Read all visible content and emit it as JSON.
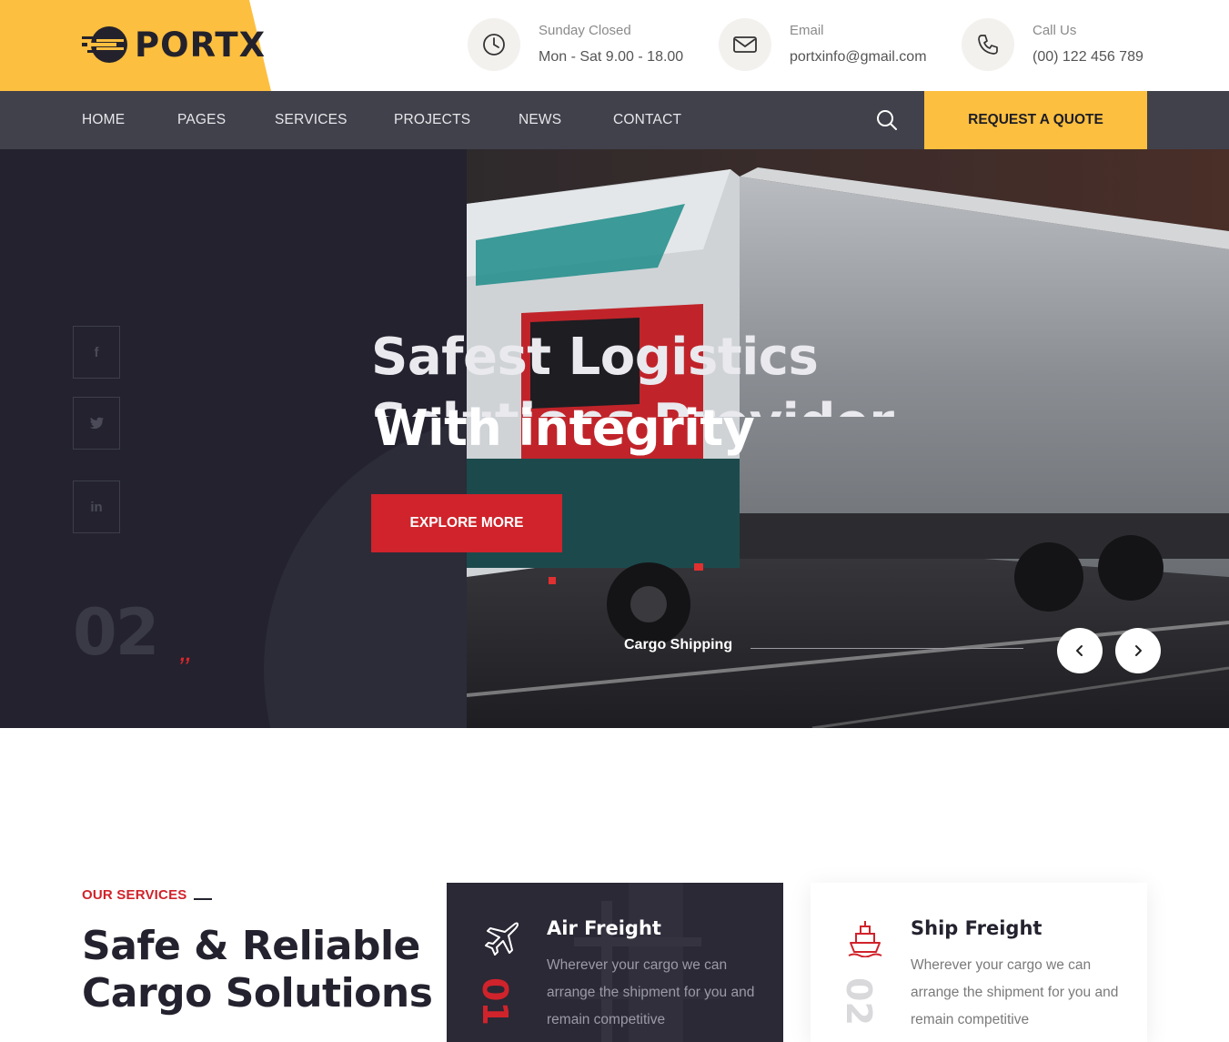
{
  "brand": {
    "name": "PORTX"
  },
  "header": {
    "hours": {
      "label": "Sunday Closed",
      "value": "Mon - Sat 9.00 - 18.00",
      "icon": "clock-icon"
    },
    "email": {
      "label": "Email",
      "value": "portxinfo@gmail.com",
      "icon": "envelope-icon"
    },
    "phone": {
      "label": "Call Us",
      "value": "(00) 122 456 789",
      "icon": "phone-icon"
    }
  },
  "nav": {
    "items": [
      "HOME",
      "PAGES",
      "SERVICES",
      "PROJECTS",
      "NEWS",
      "CONTACT"
    ],
    "quote_label": "REQUEST A QUOTE",
    "search_icon": "search-icon"
  },
  "hero": {
    "title_line1": "Safest Logistics",
    "title_line2": "Solutions Provider",
    "title_line3": "With integrity",
    "button_label": "EXPLORE MORE",
    "slide_number": "02",
    "slide_caption": "Cargo Shipping",
    "social": [
      "f",
      "t",
      "in"
    ]
  },
  "services": {
    "tag": "OUR SERVICES",
    "heading_line1": "Safe & Reliable",
    "heading_line2": "Cargo Solutions",
    "cards": [
      {
        "title": "Air Freight",
        "text": "Wherever your cargo we can arrange the shipment for you and remain competitive",
        "number": "01",
        "icon": "airplane-icon"
      },
      {
        "title": "Ship Freight",
        "text": "Wherever your cargo we can arrange the shipment for you and remain competitive",
        "number": "02",
        "icon": "ship-icon"
      }
    ]
  },
  "colors": {
    "accent_yellow": "#fdbf3f",
    "accent_red": "#d0232b",
    "dark": "#23222e",
    "nav": "#41414c"
  }
}
